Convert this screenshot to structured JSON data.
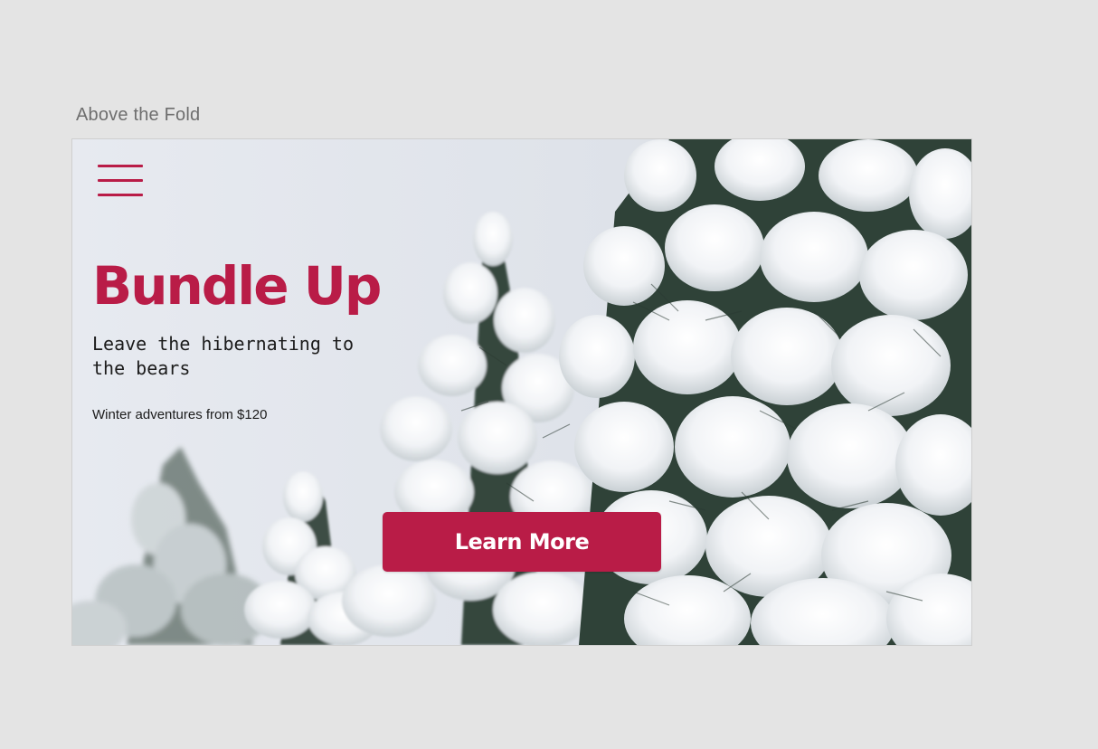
{
  "frame": {
    "label": "Above the Fold"
  },
  "hero": {
    "menu_icon": "hamburger-menu-icon",
    "headline": "Bundle Up",
    "tagline": "Leave the hibernating to the bears",
    "price_note": "Winter adventures from $120",
    "cta_label": "Learn More",
    "background": "snow-covered-pine-trees-photo"
  },
  "colors": {
    "accent": "#b91c47",
    "canvas": "#e4e4e4",
    "text": "#1c1c1c",
    "label": "#6e6e6e"
  }
}
